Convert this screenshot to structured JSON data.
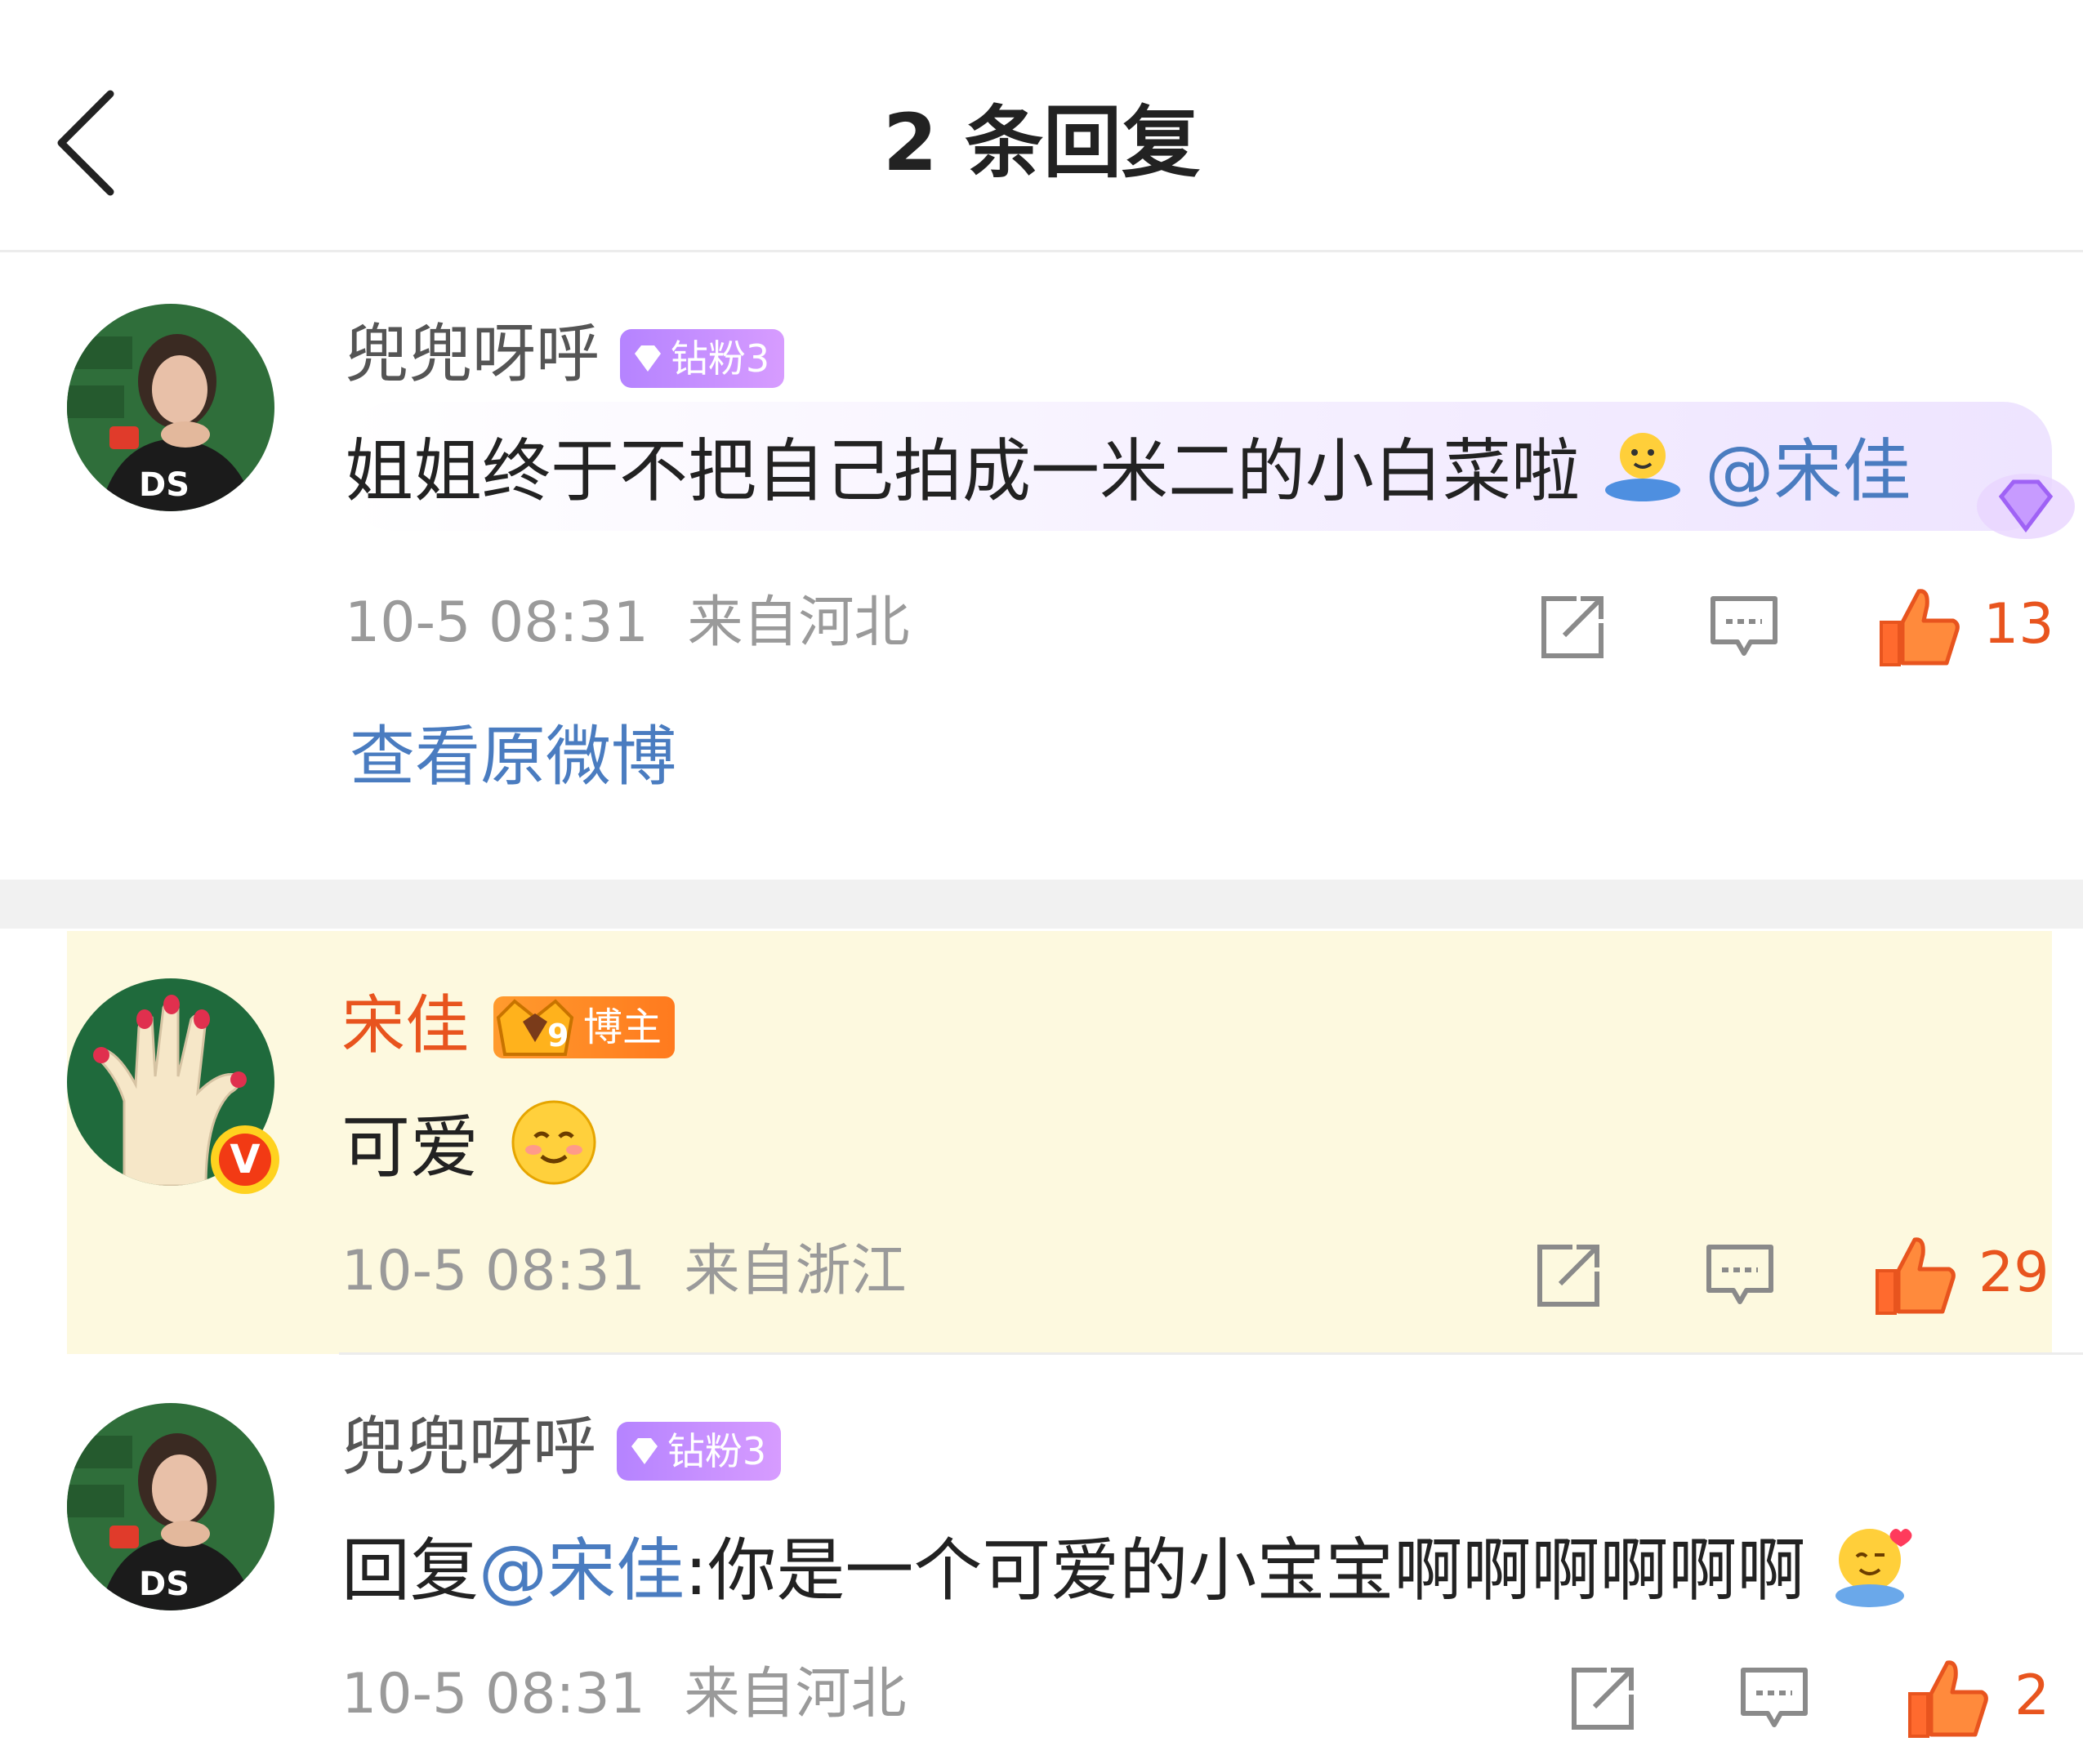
{
  "header": {
    "title": "2 条回复"
  },
  "root_comment": {
    "user": "兜兜呀呼",
    "fan_badge": "钻粉3",
    "text": "姐姐终于不把自己拍成一米二的小白菜啦",
    "mention": "@宋佳",
    "time": "10-5 08:31",
    "location": "来自河北",
    "likes": "13",
    "view_original": "查看原微博"
  },
  "replies": [
    {
      "user": "宋佳",
      "badge": "博主",
      "badge_level": "9",
      "text": "可爱",
      "time": "10-5 08:31",
      "location": "来自浙江",
      "likes": "29",
      "verified": "V"
    },
    {
      "user": "兜兜呀呼",
      "fan_badge": "钻粉3",
      "prefix": "回复",
      "mention": "@宋佳",
      "text": ":你是一个可爱的小宝宝啊啊啊啊啊啊",
      "time": "10-5 08:31",
      "location": "来自河北",
      "likes": "2"
    }
  ],
  "colors": {
    "accent_orange": "#e8541e",
    "link_blue": "#4a7cc0",
    "highlight_bg": "#fdf9df",
    "fan_badge": "#b583ff"
  }
}
